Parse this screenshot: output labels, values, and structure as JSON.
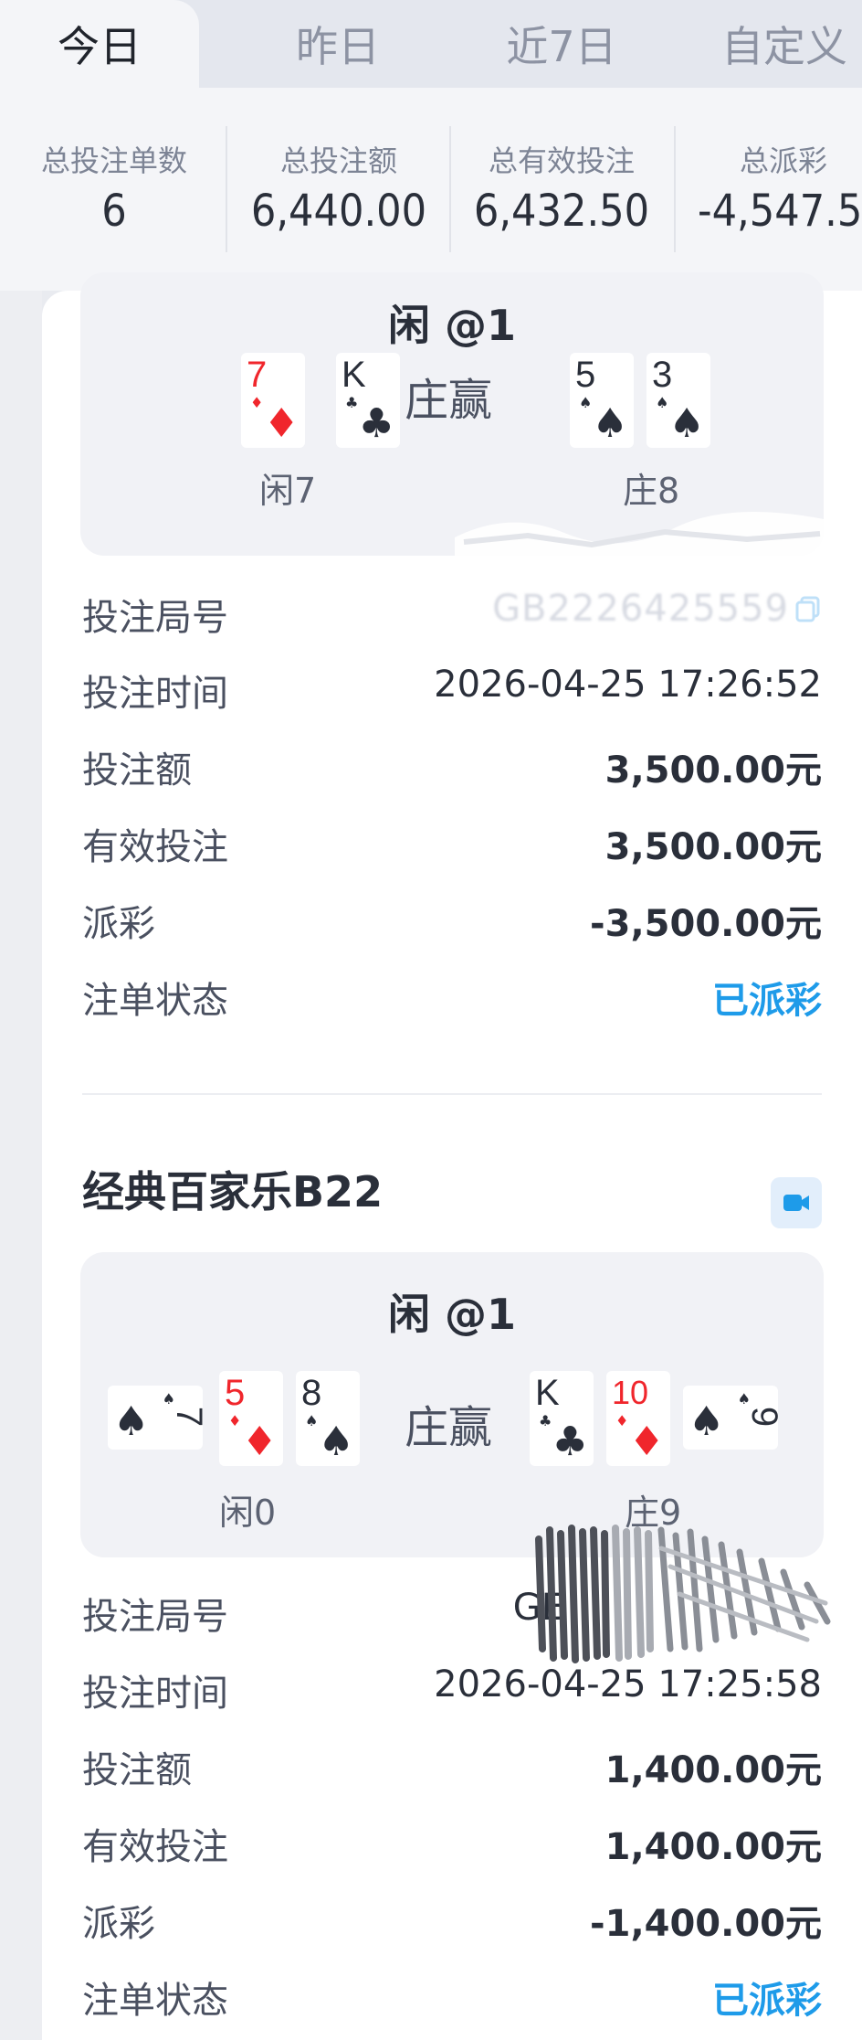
{
  "tabs": [
    "今日",
    "昨日",
    "近7日",
    "自定义"
  ],
  "stats": [
    {
      "label": "总投注单数",
      "value": "6"
    },
    {
      "label": "总投注额",
      "value": "6,440.00"
    },
    {
      "label": "总有效投注",
      "value": "6,432.50"
    },
    {
      "label": "总派彩",
      "value": "-4,547.50"
    }
  ],
  "colors": {
    "accent": "#1e9be9",
    "card_red": "#f0262c",
    "card_black": "#2a2f3a"
  },
  "bets": [
    {
      "game_title": "",
      "bet_title": "闲 @1",
      "player_cards": [
        {
          "rank": "7",
          "suit": "♦"
        },
        {
          "rank": "K",
          "suit": "♣"
        }
      ],
      "banker_cards": [
        {
          "rank": "5",
          "suit": "♠"
        },
        {
          "rank": "3",
          "suit": "♠"
        }
      ],
      "result": "庄赢",
      "player_total": "闲7",
      "banker_total": "庄8",
      "rows": [
        {
          "label": "投注局号",
          "value": "GB2226425559"
        },
        {
          "label": "投注时间",
          "value": "2026-04-25 17:26:52"
        },
        {
          "label": "投注额",
          "value": "3,500.00元"
        },
        {
          "label": "有效投注",
          "value": "3,500.00元"
        },
        {
          "label": "派彩",
          "value": "-3,500.00元"
        },
        {
          "label": "注单状态",
          "value": "已派彩"
        }
      ]
    },
    {
      "game_title": "经典百家乐B22",
      "bet_title": "闲 @1",
      "player_cards": [
        {
          "rank": "7",
          "suit": "♠"
        },
        {
          "rank": "5",
          "suit": "♦"
        },
        {
          "rank": "8",
          "suit": "♠"
        }
      ],
      "banker_cards": [
        {
          "rank": "K",
          "suit": "♣"
        },
        {
          "rank": "10",
          "suit": "♦"
        },
        {
          "rank": "9",
          "suit": "♠"
        }
      ],
      "result": "庄赢",
      "player_total": "闲0",
      "banker_total": "庄9",
      "rows": [
        {
          "label": "投注局号",
          "value": "GE"
        },
        {
          "label": "投注时间",
          "value": "2026-04-25 17:25:58"
        },
        {
          "label": "投注额",
          "value": "1,400.00元"
        },
        {
          "label": "有效投注",
          "value": "1,400.00元"
        },
        {
          "label": "派彩",
          "value": "-1,400.00元"
        },
        {
          "label": "注单状态",
          "value": "已派彩"
        }
      ]
    }
  ],
  "icons": {
    "copy": "copy-icon",
    "video": "video-icon"
  }
}
